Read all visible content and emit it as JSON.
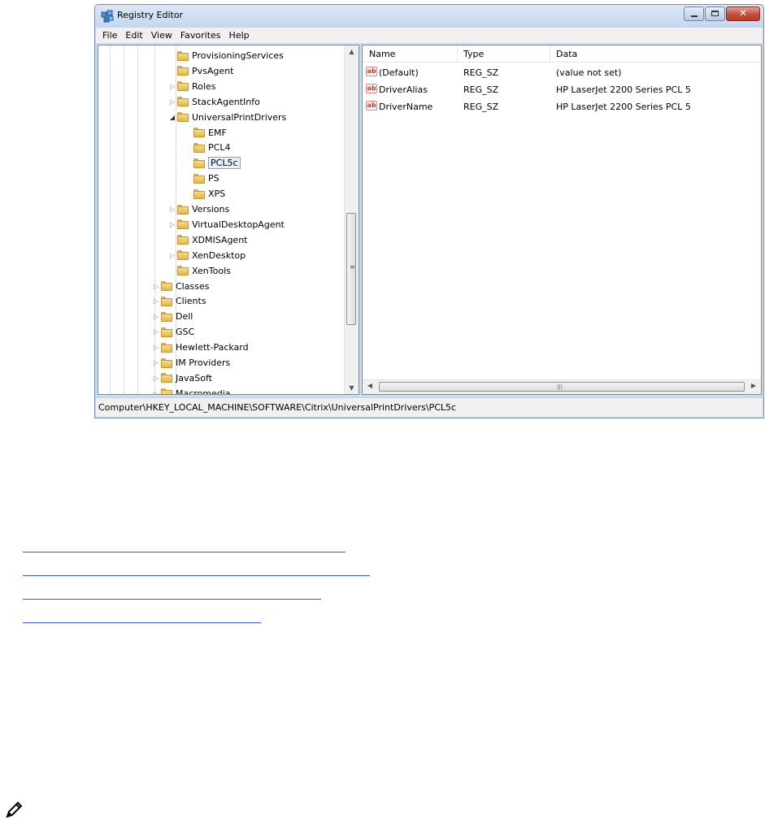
{
  "window": {
    "title": "Registry Editor",
    "menu": [
      "File",
      "Edit",
      "View",
      "Favorites",
      "Help"
    ]
  },
  "tree": {
    "items": [
      {
        "label": "ProvisioningServices",
        "depth": 3,
        "expander": "none"
      },
      {
        "label": "PvsAgent",
        "depth": 3,
        "expander": "none"
      },
      {
        "label": "Roles",
        "depth": 3,
        "expander": "collapsed"
      },
      {
        "label": "StackAgentInfo",
        "depth": 3,
        "expander": "collapsed"
      },
      {
        "label": "UniversalPrintDrivers",
        "depth": 3,
        "expander": "expanded"
      },
      {
        "label": "EMF",
        "depth": 4,
        "expander": "none"
      },
      {
        "label": "PCL4",
        "depth": 4,
        "expander": "none"
      },
      {
        "label": "PCL5c",
        "depth": 4,
        "expander": "none",
        "selected": true
      },
      {
        "label": "PS",
        "depth": 4,
        "expander": "none"
      },
      {
        "label": "XPS",
        "depth": 4,
        "expander": "none"
      },
      {
        "label": "Versions",
        "depth": 3,
        "expander": "collapsed"
      },
      {
        "label": "VirtualDesktopAgent",
        "depth": 3,
        "expander": "collapsed"
      },
      {
        "label": "XDMISAgent",
        "depth": 3,
        "expander": "none"
      },
      {
        "label": "XenDesktop",
        "depth": 3,
        "expander": "collapsed"
      },
      {
        "label": "XenTools",
        "depth": 3,
        "expander": "none"
      },
      {
        "label": "Classes",
        "depth": 2,
        "expander": "collapsed"
      },
      {
        "label": "Clients",
        "depth": 2,
        "expander": "collapsed"
      },
      {
        "label": "Dell",
        "depth": 2,
        "expander": "collapsed"
      },
      {
        "label": "GSC",
        "depth": 2,
        "expander": "collapsed"
      },
      {
        "label": "Hewlett-Packard",
        "depth": 2,
        "expander": "collapsed"
      },
      {
        "label": "IM Providers",
        "depth": 2,
        "expander": "collapsed"
      },
      {
        "label": "JavaSoft",
        "depth": 2,
        "expander": "collapsed"
      },
      {
        "label": "Macromedia",
        "depth": 2,
        "expander": "collapsed"
      }
    ]
  },
  "list": {
    "columns": [
      "Name",
      "Type",
      "Data"
    ],
    "rows": [
      {
        "name": "(Default)",
        "type": "REG_SZ",
        "data": "(value not set)"
      },
      {
        "name": "DriverAlias",
        "type": "REG_SZ",
        "data": "HP LaserJet 2200 Series PCL 5"
      },
      {
        "name": "DriverName",
        "type": "REG_SZ",
        "data": "HP LaserJet 2200 Series PCL 5"
      }
    ]
  },
  "status": {
    "path": "Computer\\HKEY_LOCAL_MACHINE\\SOFTWARE\\Citrix\\UniversalPrintDrivers\\PCL5c"
  },
  "colors": {
    "link": "#3b5bdb",
    "selection_border": "#7da2ce"
  }
}
